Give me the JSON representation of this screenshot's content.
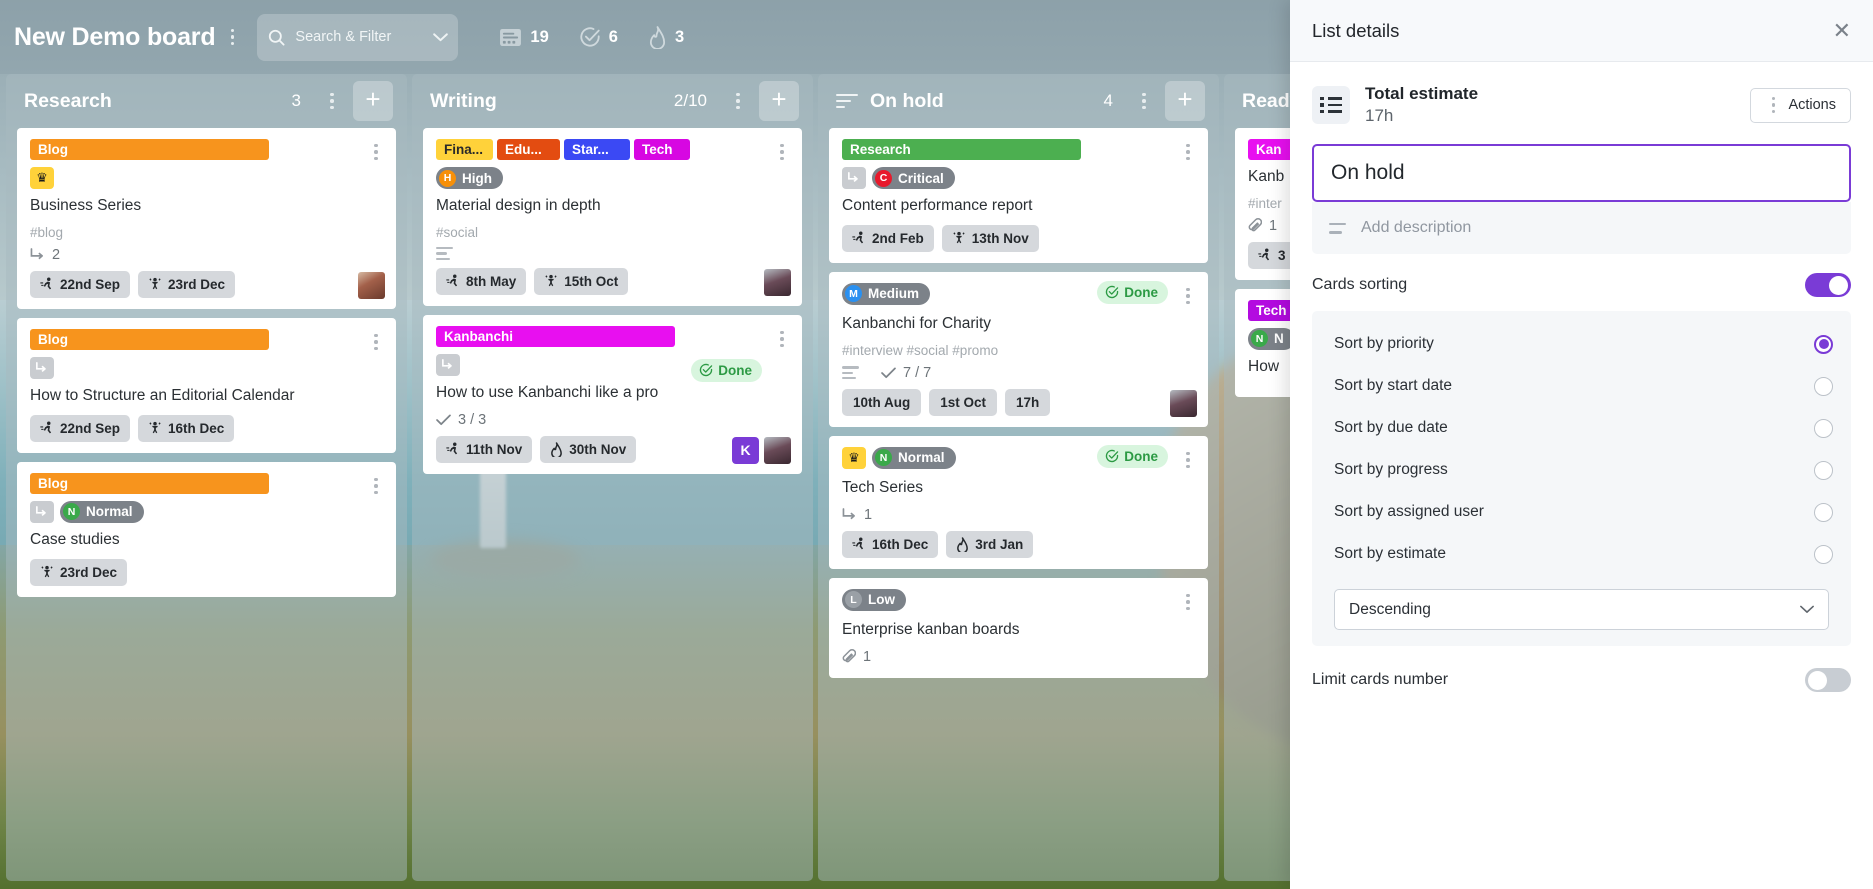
{
  "header": {
    "board_title": "New Demo board",
    "menu_icon": "kebab-menu-icon",
    "search_placeholder": "Search & Filter",
    "search_icon": "search-icon",
    "chevron_icon": "chevron-down-icon",
    "counters": [
      {
        "icon": "cards-icon",
        "value": "19"
      },
      {
        "icon": "check-circle-icon",
        "value": "6"
      },
      {
        "icon": "flame-icon",
        "value": "3"
      }
    ]
  },
  "lists": [
    {
      "name": "Research",
      "count": "3",
      "add_label": "+",
      "cards": [
        {
          "tags": [
            {
              "text": "Blog",
              "color": "#f7941d",
              "wide": true
            }
          ],
          "priority": null,
          "badges": [
            "crown-icon"
          ],
          "title": "Business Series",
          "hashtags": "#blog",
          "subtask_count": "2",
          "dates": [
            {
              "icon": "start-date-icon",
              "text": "22nd Sep"
            },
            {
              "icon": "due-date-icon",
              "text": "23rd Dec"
            }
          ],
          "avatars": [
            "photo1"
          ]
        },
        {
          "tags": [
            {
              "text": "Blog",
              "color": "#f7941d",
              "wide": true
            }
          ],
          "priority": null,
          "badges": [
            "subcard-icon"
          ],
          "title": "How to Structure an Editorial Calendar",
          "dates": [
            {
              "icon": "start-date-icon",
              "text": "22nd Sep"
            },
            {
              "icon": "due-date-icon",
              "text": "16th Dec"
            }
          ],
          "avatars": []
        },
        {
          "tags": [
            {
              "text": "Blog",
              "color": "#f7941d",
              "wide": true
            }
          ],
          "priority": {
            "letter": "N",
            "label": "Normal",
            "class": "n"
          },
          "badges": [
            "subcard-icon"
          ],
          "title": "Case studies",
          "dates": [
            {
              "icon": "due-date-icon",
              "text": "23rd Dec"
            }
          ],
          "avatars": []
        }
      ]
    },
    {
      "name": "Writing",
      "count": "2/10",
      "add_label": "+",
      "cards": [
        {
          "tags": [
            {
              "text": "Fina...",
              "cls": "w-fina"
            },
            {
              "text": "Edu...",
              "cls": "w-edu"
            },
            {
              "text": "Star...",
              "cls": "w-star"
            },
            {
              "text": "Tech",
              "cls": "w-tech"
            }
          ],
          "priority": {
            "letter": "H",
            "label": "High",
            "class": "h"
          },
          "title": "Material design in depth",
          "hashtags": "#social",
          "has_description": true,
          "dates": [
            {
              "icon": "start-date-icon",
              "text": "8th May"
            },
            {
              "icon": "due-date-icon",
              "text": "15th Oct"
            }
          ],
          "avatars": [
            "photo2"
          ]
        },
        {
          "tags": [
            {
              "text": "Kanbanchi",
              "color": "#e80ff0",
              "wide": true
            }
          ],
          "badges": [
            "subcard-icon"
          ],
          "done_label": "Done",
          "title": "How to use Kanbanchi like a pro",
          "checklist": "3 / 3",
          "dates": [
            {
              "icon": "start-date-icon",
              "text": "11th Nov"
            },
            {
              "icon": "estimate-icon",
              "text": "30th Nov"
            }
          ],
          "avatars": [
            "K",
            "photo2"
          ]
        }
      ]
    },
    {
      "name": "On hold",
      "count": "4",
      "add_label": "+",
      "has_desc_icon": true,
      "cards": [
        {
          "tags": [
            {
              "text": "Research",
              "color": "#4caf50",
              "wide": true
            }
          ],
          "priority": {
            "letter": "C",
            "label": "Critical",
            "class": "c"
          },
          "badges": [
            "subcard-icon"
          ],
          "title": "Content performance report",
          "dates": [
            {
              "icon": "start-date-icon",
              "text": "2nd Feb"
            },
            {
              "icon": "due-date-icon",
              "text": "13th Nov"
            }
          ],
          "avatars": []
        },
        {
          "priority": {
            "letter": "M",
            "label": "Medium",
            "class": "m"
          },
          "done_label": "Done",
          "title": "Kanbanchi for Charity",
          "hashtags": "#interview #social #promo",
          "has_description": true,
          "checklist": "7 / 7",
          "dates": [
            {
              "icon": "none",
              "text": "10th Aug"
            },
            {
              "icon": "none",
              "text": "1st Oct"
            },
            {
              "icon": "none",
              "text": "17h"
            }
          ],
          "avatars": [
            "photo2"
          ]
        },
        {
          "priority": {
            "letter": "N",
            "label": "Normal",
            "class": "n"
          },
          "badges": [
            "crown-icon"
          ],
          "done_label": "Done",
          "title": "Tech Series",
          "subtask_count": "1",
          "dates": [
            {
              "icon": "start-date-icon",
              "text": "16th Dec"
            },
            {
              "icon": "estimate-icon",
              "text": "3rd Jan"
            }
          ],
          "avatars": []
        },
        {
          "priority": {
            "letter": "L",
            "label": "Low",
            "class": "l"
          },
          "title": "Enterprise kanban boards",
          "attachments": "1",
          "dates": [],
          "avatars": []
        }
      ]
    },
    {
      "name": "Ready",
      "count": "",
      "add_label": "+",
      "cards": [
        {
          "tags": [
            {
              "text": "Kan",
              "color": "#e80ff0",
              "wide": true
            }
          ],
          "title": "Kanb",
          "hashtags": "#inter",
          "attachments": "1",
          "dates": [
            {
              "icon": "start-date-icon",
              "text": "3"
            }
          ],
          "avatars": []
        },
        {
          "tags": [
            {
              "text": "Tech",
              "color": "#b30be0",
              "wide": true
            }
          ],
          "priority": {
            "letter": "N",
            "label": "N",
            "class": "n"
          },
          "title": "How",
          "dates": [],
          "avatars": []
        }
      ]
    }
  ],
  "panel": {
    "title": "List details",
    "close_icon": "close-icon",
    "estimate_icon": "list-estimate-icon",
    "estimate_label": "Total estimate",
    "estimate_value": "17h",
    "actions_label": "Actions",
    "actions_icon": "kebab-menu-icon",
    "list_name_value": "On hold",
    "description_placeholder": "Add description",
    "description_icon": "description-icon",
    "cards_sorting_label": "Cards sorting",
    "cards_sorting_on": true,
    "sort_options": [
      {
        "label": "Sort by priority",
        "selected": true
      },
      {
        "label": "Sort by start date",
        "selected": false
      },
      {
        "label": "Sort by due date",
        "selected": false
      },
      {
        "label": "Sort by progress",
        "selected": false
      },
      {
        "label": "Sort by assigned user",
        "selected": false
      },
      {
        "label": "Sort by estimate",
        "selected": false
      }
    ],
    "sort_direction": "Descending",
    "sort_direction_icon": "chevron-down-icon",
    "limit_cards_label": "Limit cards number",
    "limit_cards_on": false,
    "accent_color": "#7a3bd6"
  }
}
